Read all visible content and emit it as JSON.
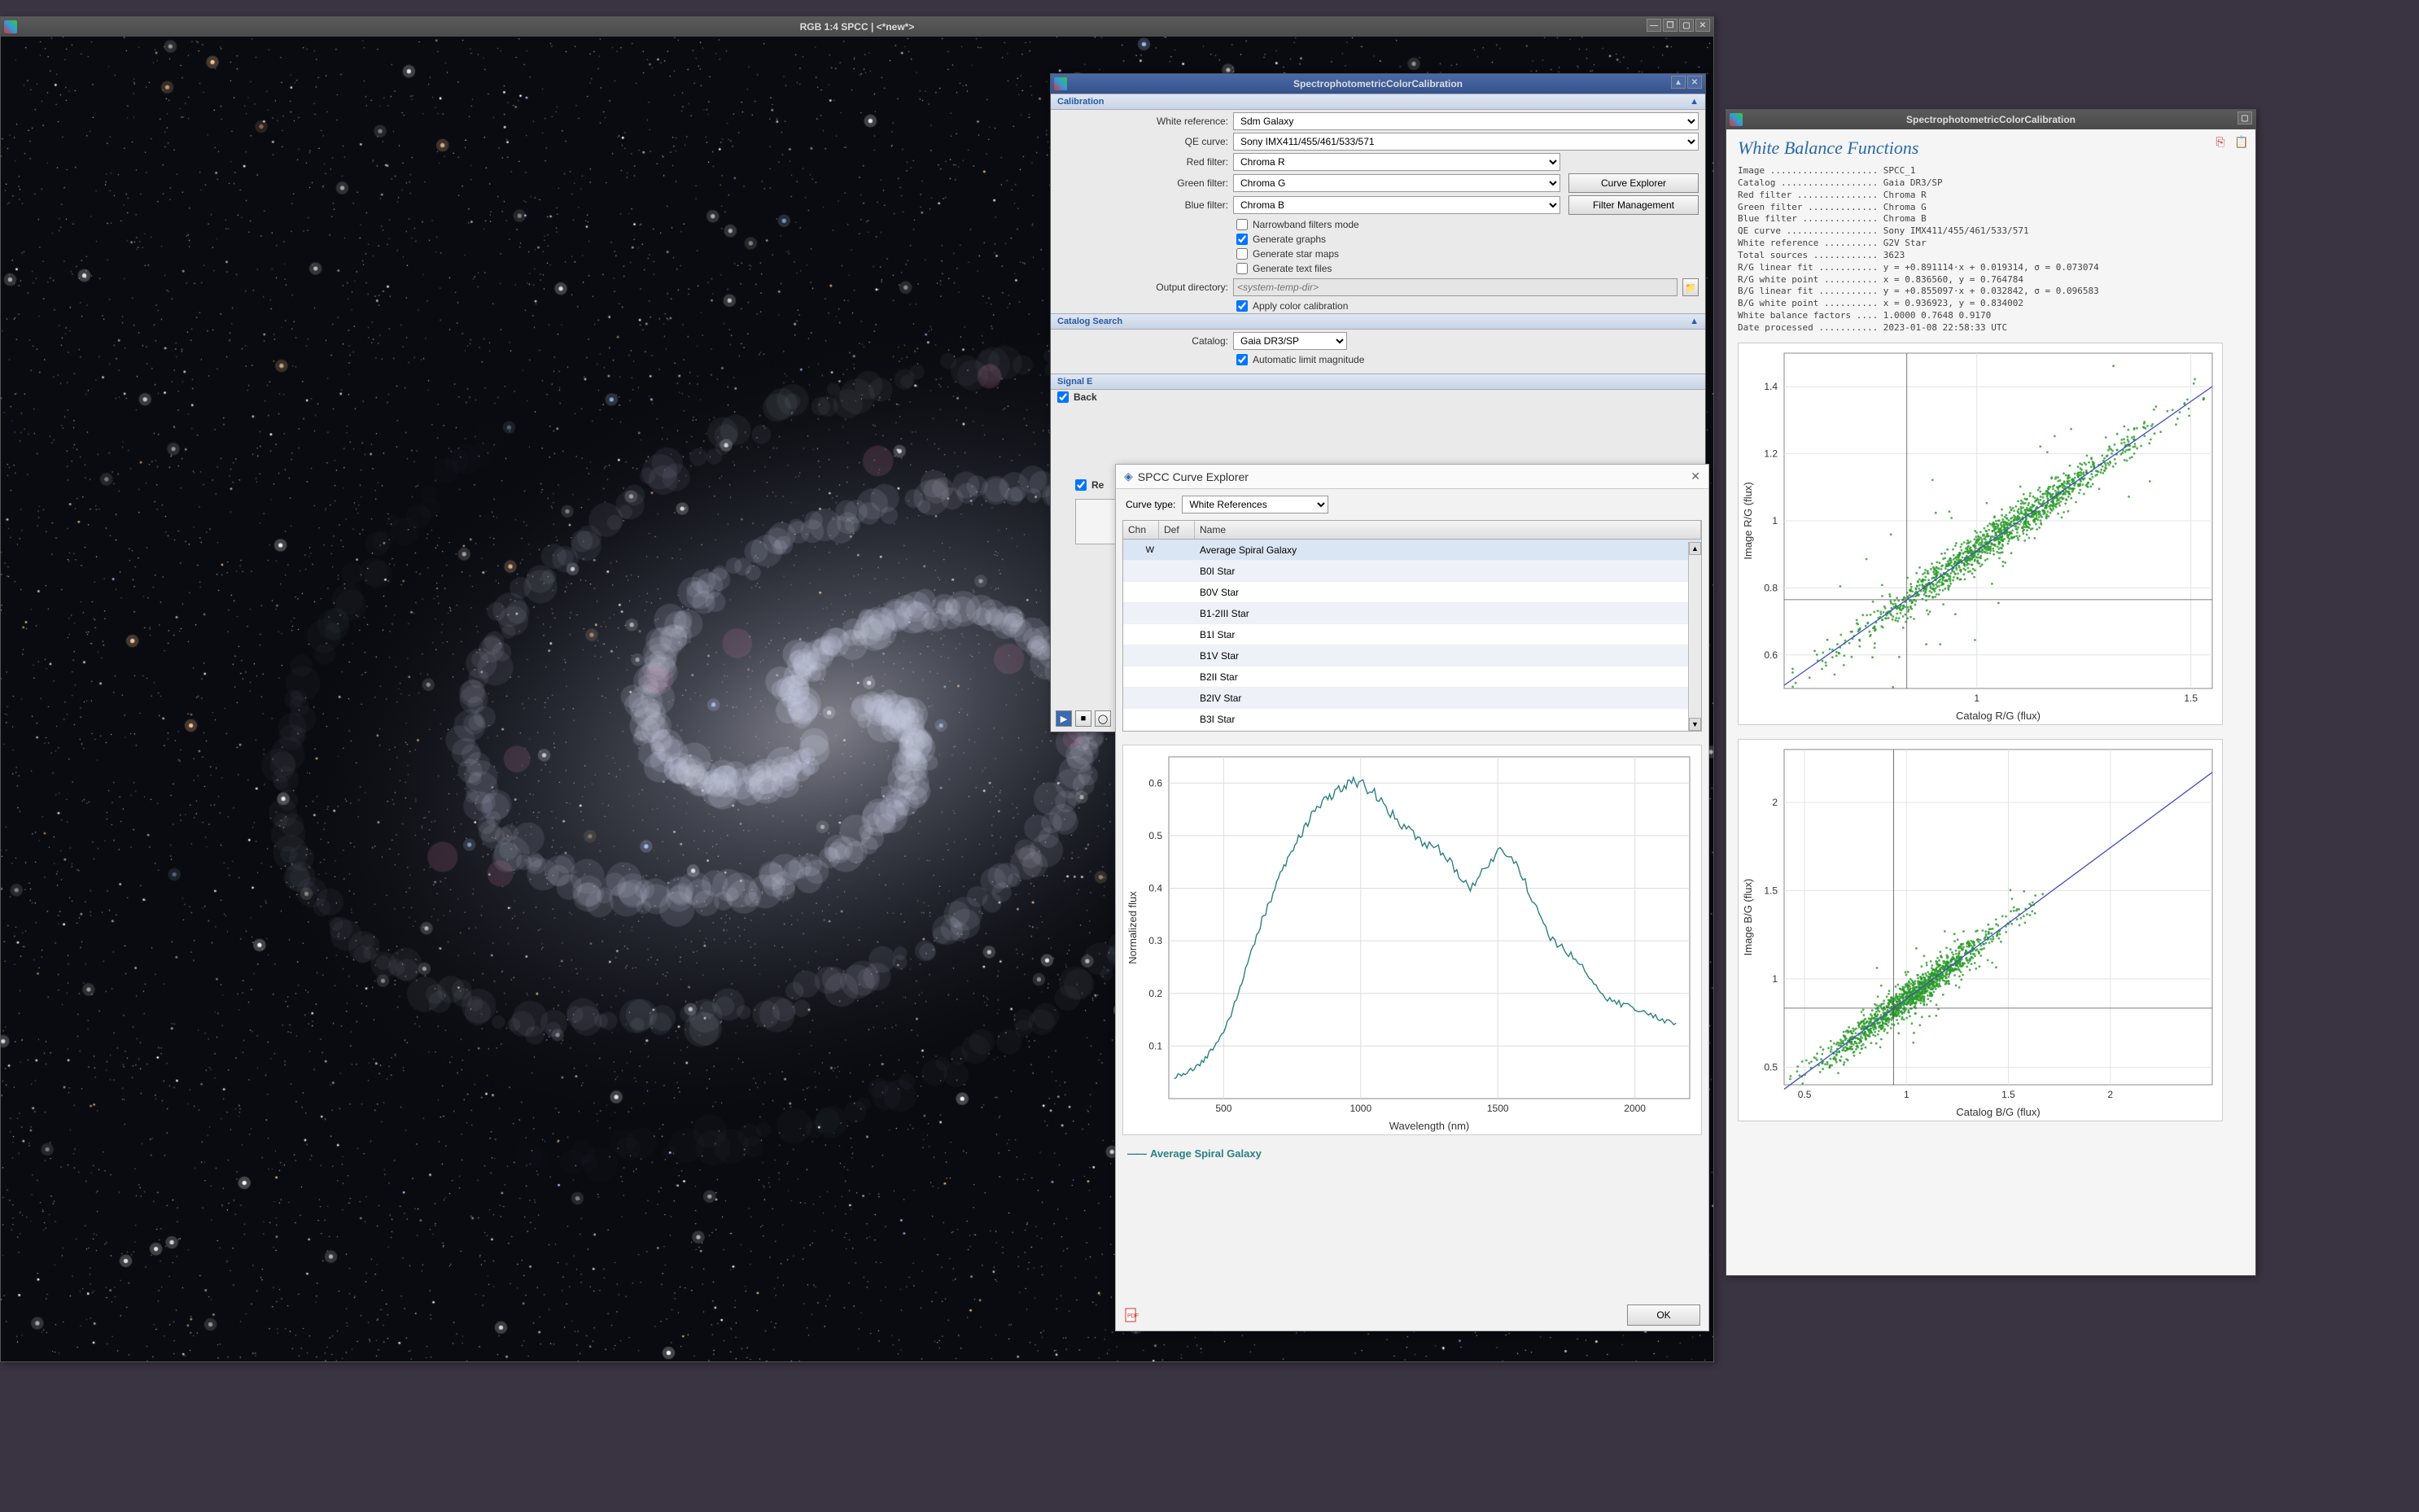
{
  "image_window": {
    "title": "RGB 1:4 SPCC | <*new*>"
  },
  "spcc": {
    "title": "SpectrophotometricColorCalibration",
    "sections": {
      "calibration": "Calibration",
      "catalog": "Catalog Search",
      "signal": "Signal E",
      "back": "Back"
    },
    "labels": {
      "white_ref": "White reference:",
      "qe_curve": "QE curve:",
      "red_filter": "Red filter:",
      "green_filter": "Green filter:",
      "blue_filter": "Blue filter:",
      "output_dir": "Output directory:",
      "catalog": "Catalog:"
    },
    "values": {
      "white_ref": "Sdm Galaxy",
      "qe_curve": "Sony IMX411/455/461/533/571",
      "red_filter": "Chroma R",
      "green_filter": "Chroma G",
      "blue_filter": "Chroma B",
      "output_dir_placeholder": "<system-temp-dir>",
      "catalog": "Gaia DR3/SP"
    },
    "buttons": {
      "curve_explorer": "Curve Explorer",
      "filter_mgmt": "Filter Management"
    },
    "checks": {
      "narrowband": "Narrowband filters mode",
      "gen_graphs": "Generate graphs",
      "gen_starmaps": "Generate star maps",
      "gen_text": "Generate text files",
      "apply_cc": "Apply color calibration",
      "auto_limit_mag": "Automatic limit magnitude",
      "re": "Re"
    }
  },
  "curve_explorer": {
    "title": "SPCC Curve Explorer",
    "curve_type_label": "Curve type:",
    "curve_type": "White References",
    "columns": {
      "chn": "Chn",
      "def": "Def",
      "name": "Name"
    },
    "rows": [
      {
        "chn": "W",
        "name": "Average Spiral Galaxy",
        "selected": true
      },
      {
        "chn": "",
        "name": "B0I Star"
      },
      {
        "chn": "",
        "name": "B0V Star"
      },
      {
        "chn": "",
        "name": "B1-2III Star"
      },
      {
        "chn": "",
        "name": "B1I Star"
      },
      {
        "chn": "",
        "name": "B1V Star"
      },
      {
        "chn": "",
        "name": "B2II Star"
      },
      {
        "chn": "",
        "name": "B2IV Star"
      },
      {
        "chn": "",
        "name": "B3I Star"
      }
    ],
    "legend": "Average Spiral Galaxy",
    "ok": "OK"
  },
  "wbf": {
    "title": "SpectrophotometricColorCalibration",
    "heading": "White Balance Functions",
    "report_lines": [
      "Image .................... SPCC_1",
      "Catalog .................. Gaia DR3/SP",
      "Red filter ............... Chroma R",
      "Green filter ............. Chroma G",
      "Blue filter .............. Chroma B",
      "QE curve ................. Sony IMX411/455/461/533/571",
      "White reference .......... G2V Star",
      "Total sources ............ 3623",
      "R/G linear fit ........... y = +0.891114·x + 0.019314, σ = 0.073074",
      "R/G white point .......... x = 0.836560, y = 0.764784",
      "B/G linear fit ........... y = +0.855097·x + 0.032842, σ = 0.096583",
      "B/G white point .......... x = 0.936923, y = 0.834002",
      "White balance factors .... 1.0000 0.7648 0.9170",
      "Date processed ........... 2023-01-08 22:58:33 UTC"
    ]
  },
  "chart_data": [
    {
      "type": "line",
      "id": "spectrum",
      "title": "",
      "xlabel": "Wavelength (nm)",
      "ylabel": "Normalized flux",
      "xlim": [
        300,
        2200
      ],
      "ylim": [
        0,
        0.65
      ],
      "xticks": [
        500,
        1000,
        1500,
        2000
      ],
      "yticks": [
        0.1,
        0.2,
        0.3,
        0.4,
        0.5,
        0.6
      ],
      "series": [
        {
          "name": "Average Spiral Galaxy",
          "color": "#2d8080",
          "x": [
            320,
            360,
            400,
            440,
            480,
            520,
            560,
            600,
            640,
            680,
            720,
            760,
            800,
            840,
            880,
            920,
            960,
            1000,
            1050,
            1100,
            1150,
            1200,
            1250,
            1300,
            1350,
            1400,
            1450,
            1500,
            1550,
            1600,
            1650,
            1700,
            1750,
            1800,
            1850,
            1900,
            1950,
            2000,
            2050,
            2100,
            2150
          ],
          "y": [
            0.04,
            0.05,
            0.06,
            0.08,
            0.11,
            0.15,
            0.21,
            0.28,
            0.34,
            0.39,
            0.44,
            0.48,
            0.52,
            0.55,
            0.57,
            0.59,
            0.6,
            0.6,
            0.58,
            0.55,
            0.52,
            0.5,
            0.48,
            0.47,
            0.43,
            0.4,
            0.44,
            0.47,
            0.46,
            0.41,
            0.35,
            0.3,
            0.28,
            0.26,
            0.22,
            0.19,
            0.18,
            0.17,
            0.16,
            0.15,
            0.14
          ]
        }
      ]
    },
    {
      "type": "scatter",
      "id": "rg_fit",
      "xlabel": "Catalog R/G (flux)",
      "ylabel": "Image R/G (flux)",
      "xlim": [
        0.55,
        1.55
      ],
      "ylim": [
        0.5,
        1.5
      ],
      "xticks": [
        1,
        1.5
      ],
      "yticks": [
        0.6,
        0.8,
        1.0,
        1.2,
        1.4
      ],
      "fit": {
        "slope": 0.891114,
        "intercept": 0.019314
      },
      "white_point": {
        "x": 0.83656,
        "y": 0.764784
      },
      "n_points": 3623
    },
    {
      "type": "scatter",
      "id": "bg_fit",
      "xlabel": "Catalog B/G (flux)",
      "ylabel": "Image B/G (flux)",
      "xlim": [
        0.4,
        2.5
      ],
      "ylim": [
        0.4,
        2.3
      ],
      "xticks": [
        0.5,
        1,
        1.5,
        2
      ],
      "yticks": [
        0.5,
        1.0,
        1.5,
        2.0
      ],
      "fit": {
        "slope": 0.855097,
        "intercept": 0.032842
      },
      "white_point": {
        "x": 0.936923,
        "y": 0.834002
      },
      "n_points": 3623
    }
  ],
  "colors": {
    "fit_line": "#4050c0",
    "scatter": "#2a9a2a",
    "spectrum": "#2d8080"
  }
}
